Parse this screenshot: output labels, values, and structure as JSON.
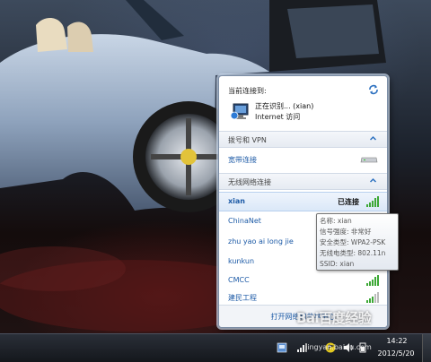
{
  "flyout": {
    "header_label": "当前连接到:",
    "current_connection": {
      "name": "正在识别... (xian)",
      "access": "Internet 访问"
    },
    "sections": [
      {
        "label": "拨号和 VPN",
        "items": [
          {
            "name": "宽带连接",
            "icon": "modem-icon"
          }
        ]
      },
      {
        "label": "无线网络连接",
        "items": [
          {
            "name": "xian",
            "status": "已连接",
            "selected": true
          },
          {
            "name": "ChinaNet"
          },
          {
            "name": "zhu yao ai long jie"
          },
          {
            "name": "kunkun"
          },
          {
            "name": "CMCC"
          },
          {
            "name": "建民工程"
          }
        ]
      }
    ],
    "footer_link": "打开网络和共享中心"
  },
  "tooltip": {
    "lines": [
      "名称: xian",
      "信号强度: 非常好",
      "安全类型: WPA2-PSK",
      "无线电类型: 802.11n",
      "SSID: xian"
    ]
  },
  "taskbar": {
    "time": "14:22",
    "date": "2012/5/20",
    "tray_icons": [
      "network-icon",
      "wireless-icon",
      "speaker-icon",
      "flag-icon",
      "battery-icon"
    ]
  },
  "watermark": {
    "logo": "Bai百度经验",
    "url": "jingyan.baidu.com"
  },
  "colors": {
    "link": "#1c5aa6",
    "signal_green": "#3da836"
  }
}
